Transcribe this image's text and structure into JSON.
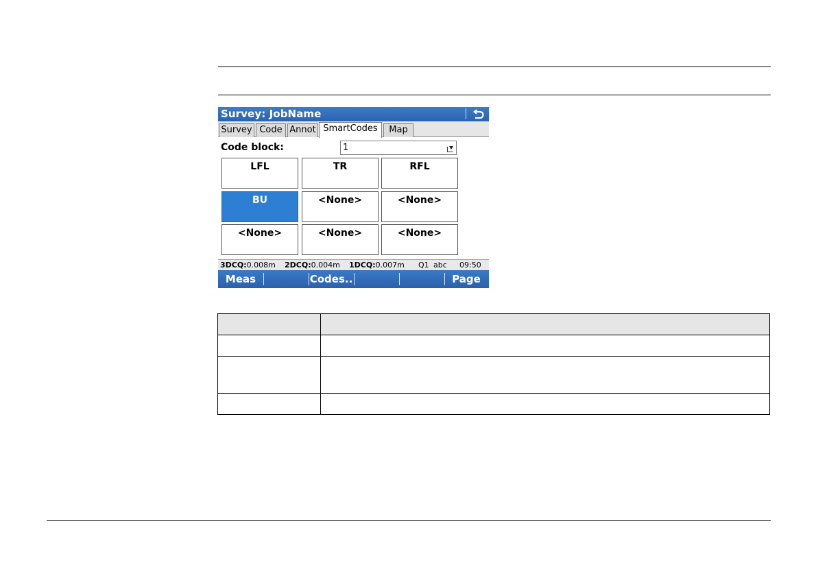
{
  "device": {
    "title": "Survey: JobName",
    "tabs": [
      "Survey",
      "Code",
      "Annot",
      "SmartCodes",
      "Map"
    ],
    "active_tab": "SmartCodes",
    "code_block": {
      "label": "Code block:",
      "value": "1"
    },
    "code_grid": [
      [
        "LFL",
        "TR",
        "RFL"
      ],
      [
        "BU",
        "<None>",
        "<None>"
      ],
      [
        "<None>",
        "<None>",
        "<None>"
      ]
    ],
    "selected_code": "BU",
    "status": {
      "q3d_label": "3DCQ:",
      "q3d_value": "0.008m",
      "q2d_label": "2DCQ:",
      "q2d_value": "0.004m",
      "q1d_label": "1DCQ:",
      "q1d_value": "0.007m",
      "solution": "Q1",
      "input_mode": "abc",
      "time": "09:50"
    },
    "function_keys": [
      "Meas",
      "",
      "Codes..",
      "",
      "",
      "Page"
    ],
    "colors": {
      "title_bar": "#2f6cb9",
      "selected_cell": "#2d7fd4",
      "function_bar": "#2f6cb9"
    },
    "icons": {
      "back": "back-arrow-icon",
      "dropdown": "dropdown-arrow-icon"
    }
  }
}
